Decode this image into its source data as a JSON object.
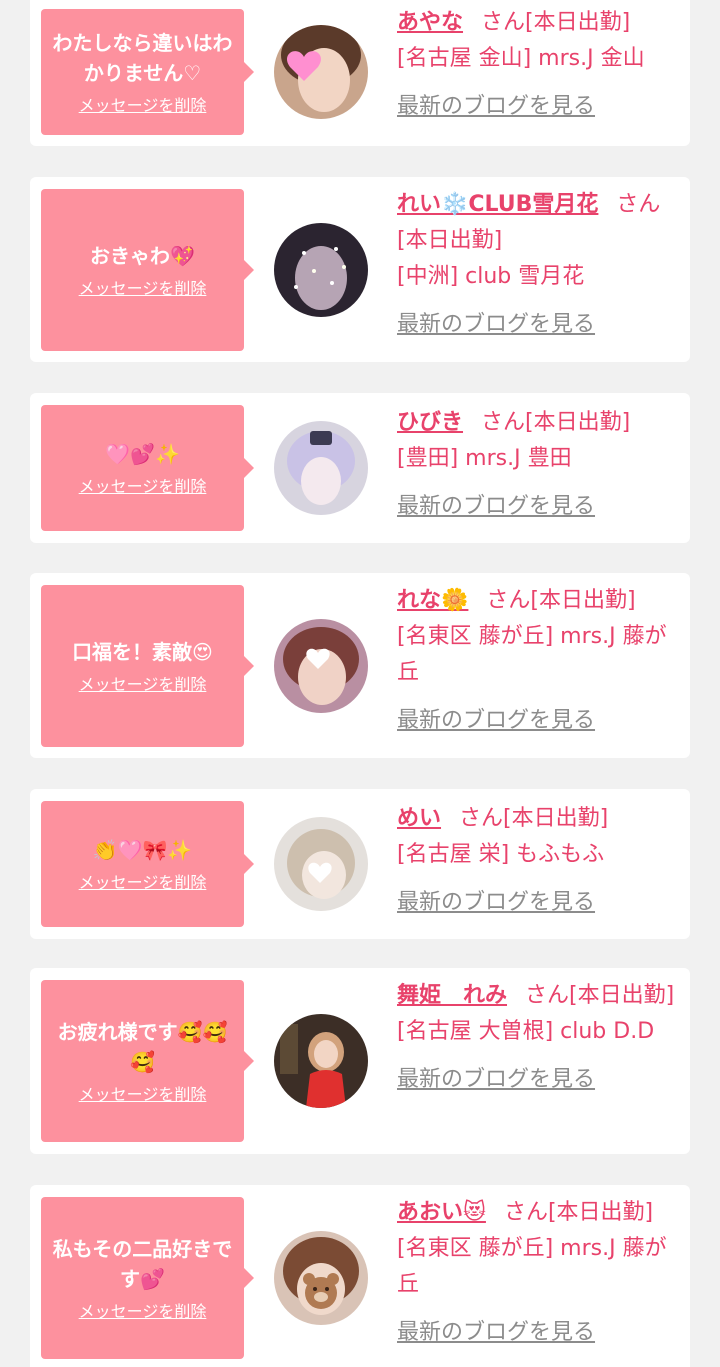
{
  "common": {
    "delete_label": "メッセージを削除",
    "blog_label": "最新のブログを見る",
    "suffix": "さん"
  },
  "colors": {
    "background": "#f1f1f1",
    "card": "#ffffff",
    "bubble": "#fd919e",
    "accent": "#e8426b",
    "link_gray": "#8c8c8c"
  },
  "items": [
    {
      "message": "わたしなら違いはわかりません♡",
      "name": "あやな",
      "status": "[本日出勤]",
      "shop": "[名古屋 金山] mrs.J 金山",
      "avatar_icon": "woman-photo-heart-sticker"
    },
    {
      "message": "おきゃわ💖",
      "name": "れい❄️CLUB雪月花",
      "status": "[本日出勤]",
      "shop": "[中洲] club 雪月花",
      "avatar_icon": "woman-photo-sparkles"
    },
    {
      "message": "🩷💕✨",
      "name": "ひびき",
      "status": "[本日出勤]",
      "shop": "[豊田] mrs.J 豊田",
      "avatar_icon": "woman-photo-cosplay"
    },
    {
      "message": "口福を！素敵😍",
      "name": "れな🌼",
      "status": "[本日出勤]",
      "shop": "[名東区 藤が丘] mrs.J 藤が丘",
      "avatar_icon": "woman-photo-heart-sticker"
    },
    {
      "message": "👏🩷🎀✨",
      "name": "めい",
      "status": "[本日出勤]",
      "shop": "[名古屋 栄] もふもふ",
      "avatar_icon": "woman-photo-maid"
    },
    {
      "message": "お疲れ様です🥰🥰🥰",
      "name": "舞姫　れみ",
      "status": "[本日出勤]",
      "shop": "[名古屋 大曽根] club D.D",
      "avatar_icon": "woman-photo-red-dress"
    },
    {
      "message": "私もその二品好きです💕",
      "name": "あおい😻",
      "status": "[本日出勤]",
      "shop": "[名東区 藤が丘] mrs.J 藤が丘",
      "avatar_icon": "woman-photo-bear-sticker"
    }
  ]
}
